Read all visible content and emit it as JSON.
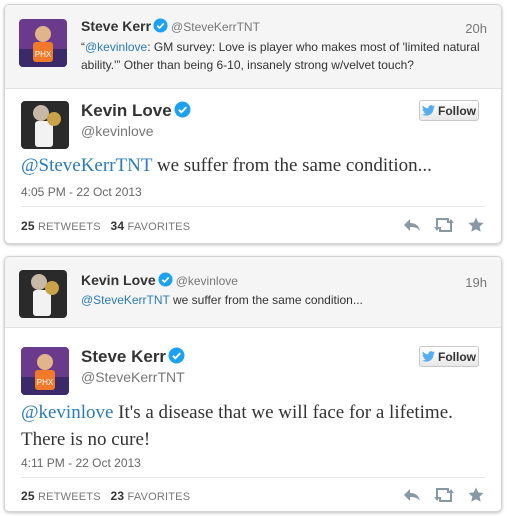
{
  "tweet1": {
    "reply": {
      "name": "Steve Kerr",
      "handle": "@SteveKerrTNT",
      "time": "20h",
      "text_open": "“",
      "mention": "@kevinlove",
      "text_line1": ": GM survey: Love is player who makes most of 'limited natural",
      "text_line2": "ability.'” Other than being 6-10, insanely strong w/velvet touch?"
    },
    "main": {
      "name": "Kevin Love",
      "handle": "@kevinlove",
      "follow_label": "Follow",
      "mention": "@SteveKerrTNT",
      "text": " we suffer from the same condition...",
      "date": "4:05 PM - 22 Oct 2013",
      "retweets": "25",
      "retweets_label": "RETWEETS",
      "favorites": "34",
      "favorites_label": "FAVORITES"
    }
  },
  "tweet2": {
    "reply": {
      "name": "Kevin Love",
      "handle": "@kevinlove",
      "time": "19h",
      "mention": "@SteveKerrTNT",
      "text": " we suffer from the same condition..."
    },
    "main": {
      "name": "Steve Kerr",
      "handle": "@SteveKerrTNT",
      "follow_label": "Follow",
      "mention": "@kevinlove",
      "text_line1": " It's a disease that we will face for a lifetime.",
      "text_line2": "There is no cure!",
      "date": "4:11 PM - 22 Oct 2013",
      "retweets": "25",
      "retweets_label": "RETWEETS",
      "favorites": "23",
      "favorites_label": "FAVORITES"
    }
  },
  "colors": {
    "link": "#2b7bb9",
    "verified": "#1da1f2",
    "twitter_bird": "#55acee"
  },
  "icons": [
    "verified-badge-icon",
    "twitter-bird-icon",
    "reply-icon",
    "retweet-icon",
    "favorite-star-icon"
  ]
}
